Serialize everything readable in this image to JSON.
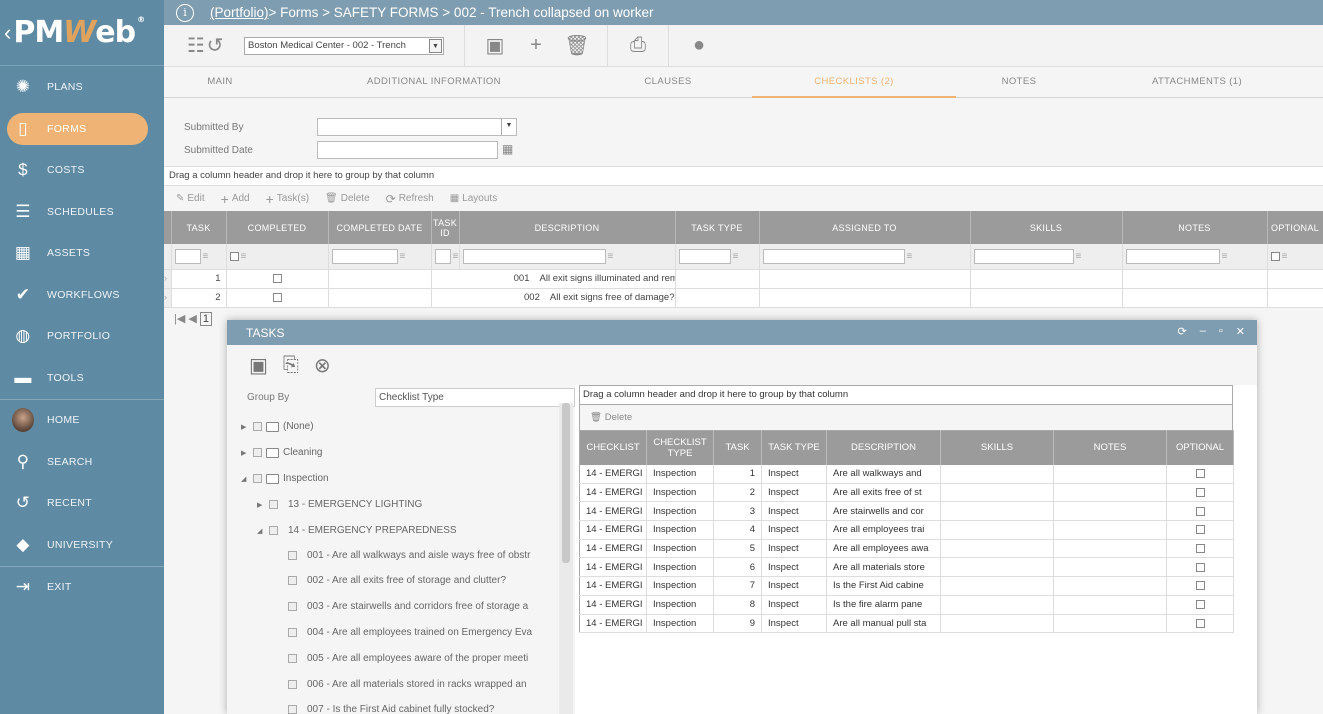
{
  "logo": {
    "text_pm": "PM",
    "text_w": "W",
    "text_eb": "eb",
    "reg": "®"
  },
  "nav": [
    {
      "label": "PLANS",
      "icon": "bulb-icon"
    },
    {
      "label": "FORMS",
      "icon": "document-icon",
      "active": true
    },
    {
      "label": "COSTS",
      "icon": "dollar-icon"
    },
    {
      "label": "SCHEDULES",
      "icon": "bars-icon"
    },
    {
      "label": "ASSETS",
      "icon": "building-icon"
    },
    {
      "label": "WORKFLOWS",
      "icon": "check-icon"
    },
    {
      "label": "PORTFOLIO",
      "icon": "globe-icon"
    },
    {
      "label": "TOOLS",
      "icon": "toolbox-icon"
    },
    {
      "label": "HOME",
      "icon": "avatar"
    },
    {
      "label": "SEARCH",
      "icon": "search-icon"
    },
    {
      "label": "RECENT",
      "icon": "history-icon"
    },
    {
      "label": "UNIVERSITY",
      "icon": "graduation-cap-icon"
    },
    {
      "label": "EXIT",
      "icon": "exit-icon"
    }
  ],
  "breadcrumb": {
    "portfolio": "(Portfolio)",
    "rest": " > Forms > SAFETY FORMS > 002 - Trench collapsed on worker"
  },
  "toolbar": {
    "record_select": "Boston Medical Center - 002 - Trench"
  },
  "tabs": [
    "MAIN",
    "ADDITIONAL INFORMATION",
    "CLAUSES",
    "CHECKLISTS (2)",
    "NOTES",
    "ATTACHMENTS (1)"
  ],
  "form": {
    "submitted_by_label": "Submitted By",
    "submitted_date_label": "Submitted Date"
  },
  "grid": {
    "group_hint": "Drag a column header and drop it here to group by that column",
    "tb_edit": "Edit",
    "tb_add": "Add",
    "tb_tasks": "Task(s)",
    "tb_delete": "Delete",
    "tb_refresh": "Refresh",
    "tb_layouts": "Layouts",
    "headers": [
      "TASK",
      "COMPLETED",
      "COMPLETED DATE",
      "TASK ID",
      "DESCRIPTION",
      "TASK TYPE",
      "ASSIGNED TO",
      "SKILLS",
      "NOTES",
      "OPTIONAL"
    ],
    "rows": [
      {
        "task": "1",
        "id": "001",
        "desc": "All exit signs illuminated and remain illum"
      },
      {
        "task": "2",
        "id": "002",
        "desc": "All exit signs free of damage?"
      }
    ],
    "page": "1"
  },
  "modal": {
    "title": "TASKS",
    "group_by_label": "Group By",
    "group_by_value": "Checklist Type",
    "tree": [
      {
        "label": "(None)",
        "level": 0,
        "type": "folder",
        "tri": "right"
      },
      {
        "label": "Cleaning",
        "level": 0,
        "type": "folder",
        "tri": "right"
      },
      {
        "label": "Inspection",
        "level": 0,
        "type": "folder",
        "tri": "down"
      },
      {
        "label": "13 - EMERGENCY LIGHTING",
        "level": 1,
        "tri": "right"
      },
      {
        "label": "14 - EMERGENCY PREPAREDNESS",
        "level": 1,
        "tri": "down"
      },
      {
        "label": "001 - Are all walkways and aisle ways free of obstr",
        "level": 2
      },
      {
        "label": "002 - Are all exits free of storage and clutter?",
        "level": 2
      },
      {
        "label": "003 - Are stairwells and corridors free of storage a",
        "level": 2
      },
      {
        "label": "004 - Are all employees trained on Emergency Eva",
        "level": 2
      },
      {
        "label": "005 - Are all employees aware of the proper meeti",
        "level": 2
      },
      {
        "label": "006 - Are all materials stored in racks wrapped an",
        "level": 2
      },
      {
        "label": "007 - Is the First Aid cabinet fully stocked?",
        "level": 2
      }
    ],
    "group_hint": "Drag a column header and drop it here to group by that column",
    "delete_label": "Delete",
    "headers": [
      "CHECKLIST",
      "CHECKLIST TYPE",
      "TASK",
      "TASK TYPE",
      "DESCRIPTION",
      "SKILLS",
      "NOTES",
      "OPTIONAL"
    ],
    "rows": [
      {
        "checklist": "14 - EMERGI",
        "type": "Inspection",
        "task": "1",
        "task_type": "Inspect",
        "desc": "Are all walkways and"
      },
      {
        "checklist": "14 - EMERGI",
        "type": "Inspection",
        "task": "2",
        "task_type": "Inspect",
        "desc": "Are all exits free of st"
      },
      {
        "checklist": "14 - EMERGI",
        "type": "Inspection",
        "task": "3",
        "task_type": "Inspect",
        "desc": "Are stairwells and cor"
      },
      {
        "checklist": "14 - EMERGI",
        "type": "Inspection",
        "task": "4",
        "task_type": "Inspect",
        "desc": "Are all employees trai"
      },
      {
        "checklist": "14 - EMERGI",
        "type": "Inspection",
        "task": "5",
        "task_type": "Inspect",
        "desc": "Are all employees awa"
      },
      {
        "checklist": "14 - EMERGI",
        "type": "Inspection",
        "task": "6",
        "task_type": "Inspect",
        "desc": "Are all materials store"
      },
      {
        "checklist": "14 - EMERGI",
        "type": "Inspection",
        "task": "7",
        "task_type": "Inspect",
        "desc": "Is the First Aid cabine"
      },
      {
        "checklist": "14 - EMERGI",
        "type": "Inspection",
        "task": "8",
        "task_type": "Inspect",
        "desc": "Is the fire alarm pane"
      },
      {
        "checklist": "14 - EMERGI",
        "type": "Inspection",
        "task": "9",
        "task_type": "Inspect",
        "desc": "Are all manual pull sta"
      }
    ]
  }
}
